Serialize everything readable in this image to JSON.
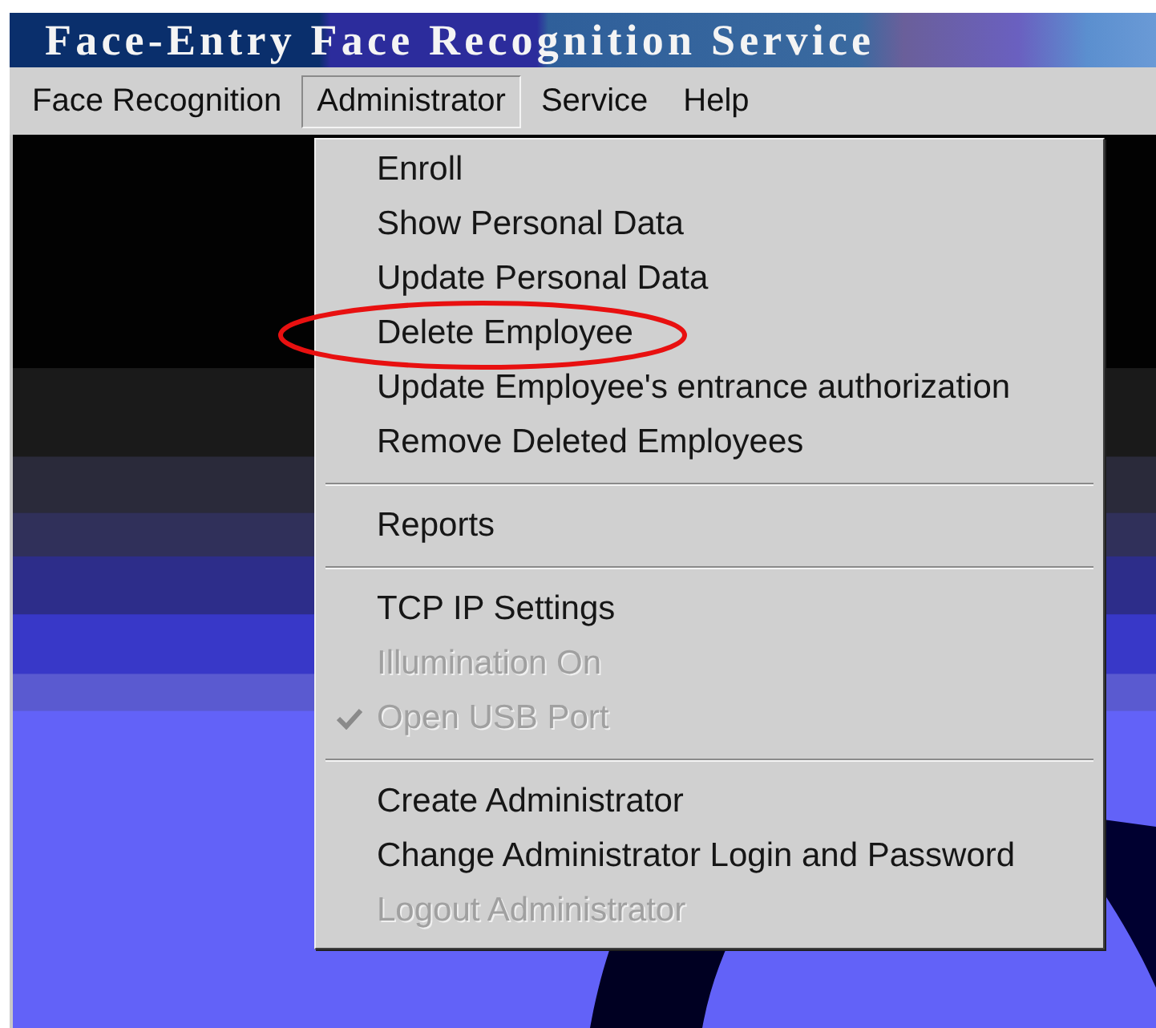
{
  "window": {
    "title": "Face-Entry Face Recognition Service"
  },
  "menu_bar": [
    {
      "label": "Face Recognition",
      "selected": false
    },
    {
      "label": "Administrator",
      "selected": true
    },
    {
      "label": "Service",
      "selected": false
    },
    {
      "label": "Help",
      "selected": false
    }
  ],
  "dropdown": {
    "items": [
      {
        "kind": "item",
        "label": "Enroll",
        "disabled": false,
        "checked": false,
        "circled": false
      },
      {
        "kind": "item",
        "label": "Show Personal Data",
        "disabled": false,
        "checked": false,
        "circled": false
      },
      {
        "kind": "item",
        "label": "Update Personal Data",
        "disabled": false,
        "checked": false,
        "circled": false
      },
      {
        "kind": "item",
        "label": "Delete Employee",
        "disabled": false,
        "checked": false,
        "circled": true
      },
      {
        "kind": "item",
        "label": "Update Employee's entrance authorization",
        "disabled": false,
        "checked": false,
        "circled": false
      },
      {
        "kind": "item",
        "label": "Remove Deleted Employees",
        "disabled": false,
        "checked": false,
        "circled": false
      },
      {
        "kind": "separator"
      },
      {
        "kind": "item",
        "label": "Reports",
        "disabled": false,
        "checked": false,
        "circled": false
      },
      {
        "kind": "separator"
      },
      {
        "kind": "item",
        "label": "TCP IP Settings",
        "disabled": false,
        "checked": false,
        "circled": false
      },
      {
        "kind": "item",
        "label": "Illumination On",
        "disabled": true,
        "checked": false,
        "circled": false
      },
      {
        "kind": "item",
        "label": "Open USB Port",
        "disabled": true,
        "checked": true,
        "circled": false
      },
      {
        "kind": "separator"
      },
      {
        "kind": "item",
        "label": "Create Administrator",
        "disabled": false,
        "checked": false,
        "circled": false
      },
      {
        "kind": "item",
        "label": "Change Administrator Login and Password",
        "disabled": false,
        "checked": false,
        "circled": false
      },
      {
        "kind": "item",
        "label": "Logout Administrator",
        "disabled": true,
        "checked": false,
        "circled": false
      }
    ]
  }
}
